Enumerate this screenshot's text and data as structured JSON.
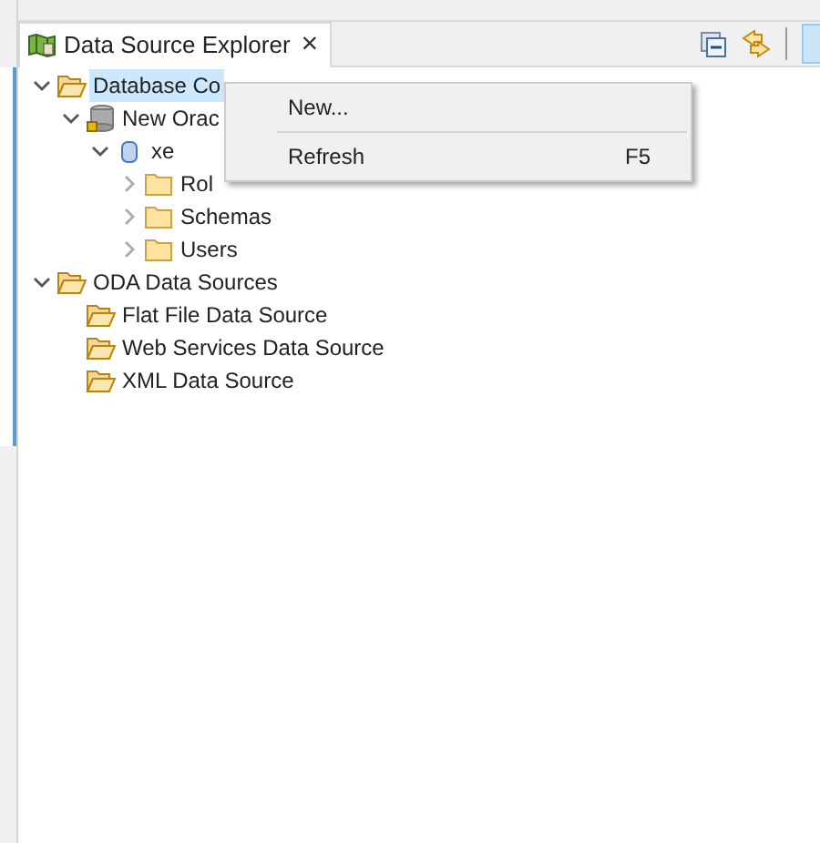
{
  "tab": {
    "title": "Data Source Explorer",
    "close": "×"
  },
  "tree": [
    {
      "label": "Database Co",
      "kind": "folder-open",
      "expanded": true,
      "selected": true,
      "children": [
        {
          "label": "New Orac",
          "kind": "database",
          "expanded": true,
          "selected": false,
          "children": [
            {
              "label": "xe",
              "kind": "instance",
              "expanded": true,
              "selected": false,
              "children": [
                {
                  "label": "Rol",
                  "kind": "folder",
                  "expanded": false,
                  "selected": false
                },
                {
                  "label": "Schemas",
                  "kind": "folder",
                  "expanded": false,
                  "selected": false
                },
                {
                  "label": "Users",
                  "kind": "folder",
                  "expanded": false,
                  "selected": false
                }
              ]
            }
          ]
        }
      ]
    },
    {
      "label": "ODA Data Sources",
      "kind": "folder-open",
      "expanded": true,
      "selected": false,
      "children": [
        {
          "label": "Flat File Data Source",
          "kind": "folder-open",
          "selected": false
        },
        {
          "label": "Web Services Data Source",
          "kind": "folder-open",
          "selected": false
        },
        {
          "label": "XML Data Source",
          "kind": "folder-open",
          "selected": false
        }
      ]
    }
  ],
  "context_menu": {
    "items": [
      {
        "kind": "item",
        "label": "New..."
      },
      {
        "kind": "separator"
      },
      {
        "kind": "item",
        "label": "Refresh",
        "shortcut": "F5"
      }
    ]
  }
}
